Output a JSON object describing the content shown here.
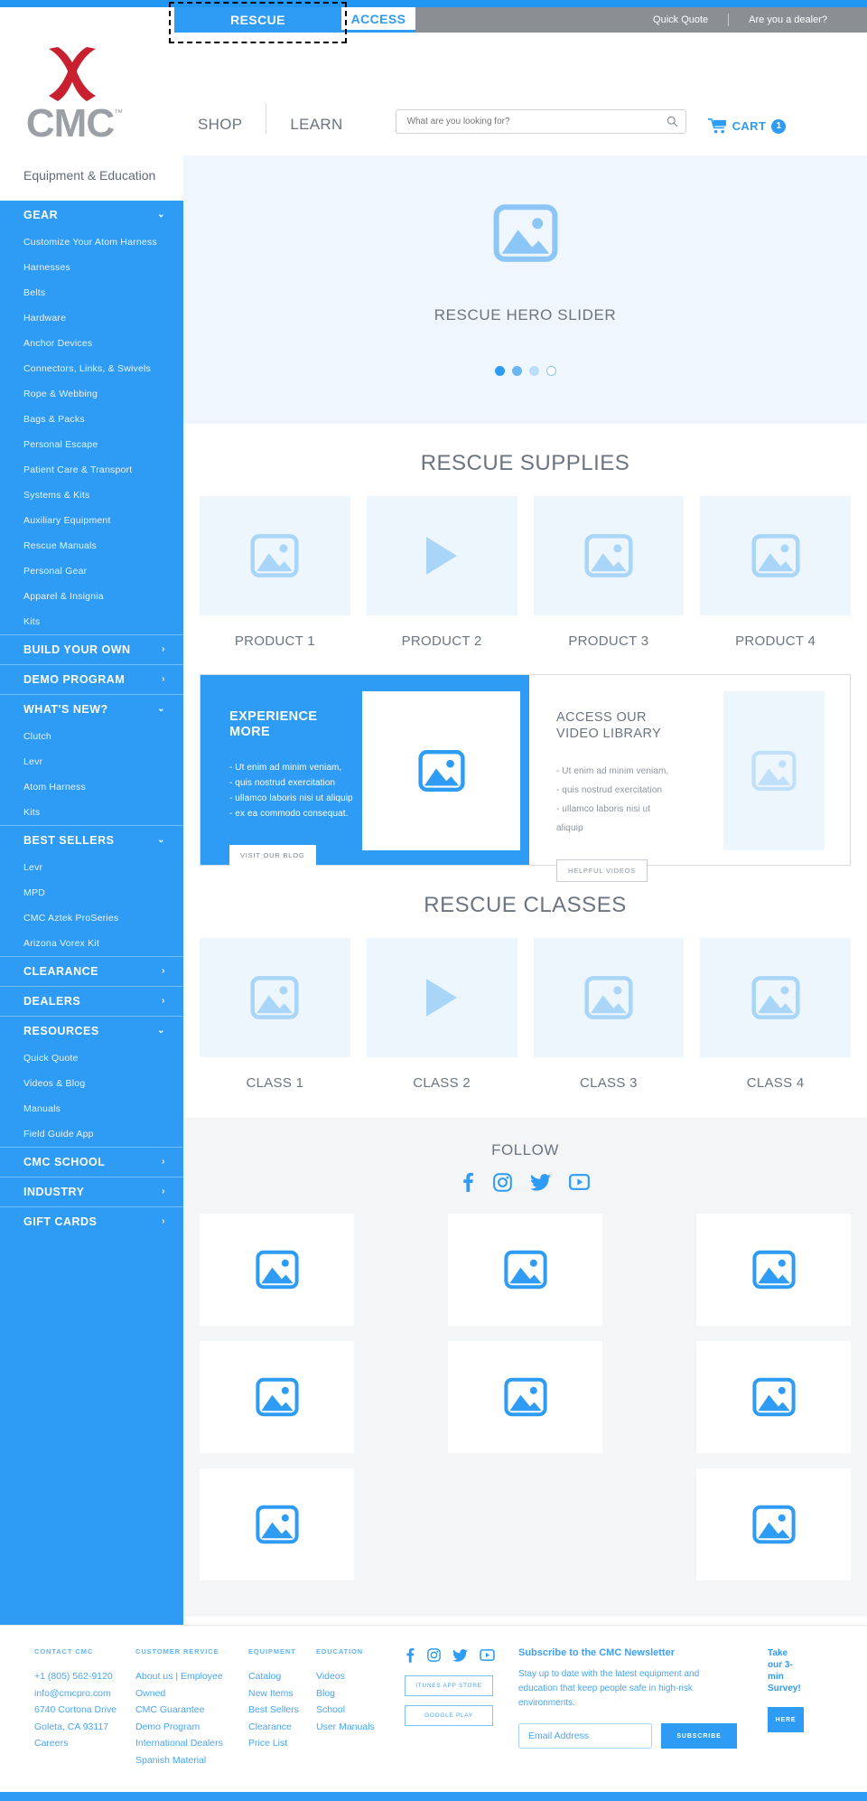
{
  "topbar": {
    "tabs": [
      {
        "label": "RESCUE",
        "active": true,
        "focused": true
      },
      {
        "label": "ACCESS",
        "active": false,
        "focused": false
      }
    ],
    "links": [
      {
        "label": "Quick Quote"
      },
      {
        "label": "Are you a dealer?"
      }
    ]
  },
  "header": {
    "logo_text": "CMC",
    "logo_tm": "™",
    "nav": [
      {
        "label": "SHOP"
      },
      {
        "label": "LEARN"
      }
    ],
    "search": {
      "placeholder": "What are you looking for?",
      "value": ""
    },
    "cart": {
      "label": "CART",
      "count": "1"
    }
  },
  "sidebar": {
    "tagline": "Equipment & Education",
    "groups": [
      {
        "label": "GEAR",
        "chevron": "⌄",
        "expanded": true,
        "items": [
          {
            "label": "Customize Your Atom Harness"
          },
          {
            "label": "Harnesses"
          },
          {
            "label": "Belts"
          },
          {
            "label": "Hardware"
          },
          {
            "label": "Anchor Devices"
          },
          {
            "label": "Connectors, Links, & Swivels"
          },
          {
            "label": "Rope & Webbing"
          },
          {
            "label": "Bags & Packs"
          },
          {
            "label": "Personal Escape"
          },
          {
            "label": "Patient Care & Transport"
          },
          {
            "label": "Systems & Kits"
          },
          {
            "label": "Auxiliary Equipment"
          },
          {
            "label": "Rescue Manuals"
          },
          {
            "label": "Personal Gear"
          },
          {
            "label": "Apparel & Insignia"
          },
          {
            "label": "Kits"
          }
        ]
      },
      {
        "label": "BUILD YOUR OWN",
        "chevron": "›",
        "expanded": false,
        "items": []
      },
      {
        "label": "DEMO PROGRAM",
        "chevron": "›",
        "expanded": false,
        "items": []
      },
      {
        "label": "WHAT'S NEW?",
        "chevron": "⌄",
        "expanded": true,
        "items": [
          {
            "label": "Clutch"
          },
          {
            "label": "Levr"
          },
          {
            "label": "Atom Harness"
          },
          {
            "label": "Kits"
          }
        ]
      },
      {
        "label": "BEST SELLERS",
        "chevron": "⌄",
        "expanded": true,
        "items": [
          {
            "label": "Levr"
          },
          {
            "label": "MPD"
          },
          {
            "label": "CMC Aztek ProSeries"
          },
          {
            "label": "Arizona Vorex Kit"
          }
        ]
      },
      {
        "label": "CLEARANCE",
        "chevron": "›",
        "expanded": false,
        "items": []
      },
      {
        "label": "DEALERS",
        "chevron": "›",
        "expanded": false,
        "items": []
      },
      {
        "label": "RESOURCES",
        "chevron": "⌄",
        "expanded": true,
        "items": [
          {
            "label": "Quick Quote"
          },
          {
            "label": "Videos & Blog"
          },
          {
            "label": "Manuals"
          },
          {
            "label": "Field Guide App"
          }
        ]
      },
      {
        "label": "CMC SCHOOL",
        "chevron": "›",
        "expanded": false,
        "items": []
      },
      {
        "label": "INDUSTRY",
        "chevron": "›",
        "expanded": false,
        "items": []
      },
      {
        "label": "GIFT CARDS",
        "chevron": "›",
        "expanded": false,
        "items": []
      }
    ]
  },
  "hero": {
    "caption": "RESCUE HERO SLIDER",
    "dots": 4,
    "active_dot": 1
  },
  "supplies": {
    "title": "RESCUE SUPPLIES",
    "cards": [
      {
        "label": "PRODUCT 1",
        "thumb": "image-placeholder-icon"
      },
      {
        "label": "PRODUCT 2",
        "thumb": "play-icon"
      },
      {
        "label": "PRODUCT 3",
        "thumb": "image-placeholder-icon"
      },
      {
        "label": "PRODUCT 4",
        "thumb": "image-placeholder-icon"
      }
    ]
  },
  "promo": {
    "left": {
      "title_line1": "EXPERIENCE",
      "title_line2": "MORE",
      "bullets": [
        "- Ut enim ad minim veniam,",
        "- quis nostrud exercitation",
        "- ullamco laboris nisi ut aliquip",
        "- ex ea commodo consequat."
      ],
      "button": "VISIT OUR BLOG"
    },
    "right": {
      "title_line1": "ACCESS OUR",
      "title_line2": "VIDEO LIBRARY",
      "bullets": [
        "- Ut enim ad minim veniam,",
        "- quis nostrud exercitation",
        "- ullamco laboris nisi ut",
        "aliquip"
      ],
      "button": "HELPFUL VIDEOS"
    }
  },
  "classes": {
    "title": "RESCUE CLASSES",
    "cards": [
      {
        "label": "CLASS 1",
        "thumb": "image-placeholder-icon"
      },
      {
        "label": "CLASS 2",
        "thumb": "play-icon"
      },
      {
        "label": "CLASS 3",
        "thumb": "image-placeholder-icon"
      },
      {
        "label": "CLASS 4",
        "thumb": "image-placeholder-icon"
      }
    ]
  },
  "follow": {
    "title": "FOLLOW",
    "icons": [
      "facebook-icon",
      "instagram-icon",
      "twitter-icon",
      "youtube-icon"
    ],
    "tiles": 8
  },
  "footer": {
    "columns": [
      {
        "head": "CONTACT CMC",
        "links": [
          "+1 (805) 562-9120",
          "info@cmcpro.com",
          "6740 Cortona Drive",
          "Goleta, CA 93117",
          "Careers"
        ]
      },
      {
        "head": "CUSTOMER RERVICE",
        "links": [
          "About us | Employee Owned",
          "CMC Guarantee",
          "Demo Program",
          "International Dealers",
          "Spanish Material"
        ]
      },
      {
        "head": "EQUIPMENT",
        "links": [
          "Catalog",
          "New Items",
          "Best Sellers",
          "Clearance",
          "Price List"
        ]
      },
      {
        "head": "EDUCATION",
        "links": [
          "Videos",
          "Blog",
          "School",
          "User Manuals"
        ]
      }
    ],
    "social_icons": [
      "facebook-icon",
      "instagram-icon",
      "twitter-icon",
      "youtube-icon"
    ],
    "store_buttons": [
      "ITUNES APP STORE",
      "GOOGLE PLAY"
    ],
    "newsletter": {
      "heading": "Subscribe to the CMC Newsletter",
      "body": "Stay up to date with the latest equipment and education that keep people safe in high-risk environments.",
      "email_placeholder": "Email Address",
      "email_value": "",
      "subscribe_label": "SUBSCRIBE"
    },
    "survey": {
      "heading": "Take our 3-min Survey!",
      "button": "HERE"
    }
  },
  "colors": {
    "brand_blue": "#2e9bf4",
    "logo_red": "#c8202e",
    "logo_gray": "#9aa0a6",
    "text_gray": "#6b7580",
    "light_blue_bg": "#eef6fd"
  }
}
